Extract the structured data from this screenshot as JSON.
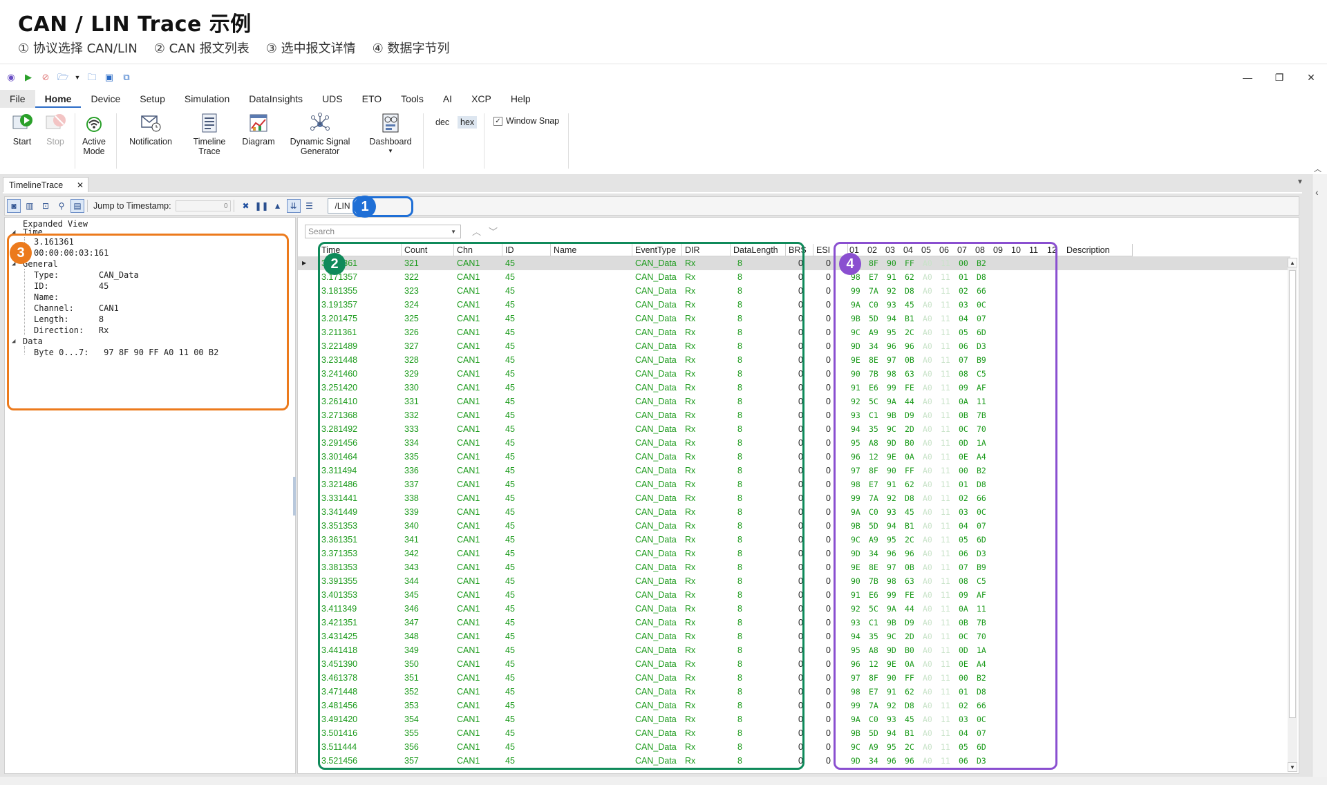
{
  "doc": {
    "title": "CAN / LIN Trace 示例",
    "steps": [
      "① 协议选择 CAN/LIN",
      "② CAN 报文列表",
      "③ 选中报文详情",
      "④ 数据字节列"
    ]
  },
  "menu": [
    "File",
    "Home",
    "Device",
    "Setup",
    "Simulation",
    "DataInsights",
    "UDS",
    "ETO",
    "Tools",
    "AI",
    "XCP",
    "Help"
  ],
  "ribbon": {
    "start": "Start",
    "stop": "Stop",
    "active_mode": "Active\nMode",
    "notification": "Notification",
    "timeline_trace": "Timeline\nTrace",
    "diagram": "Diagram",
    "dynamic_signal": "Dynamic Signal\nGenerator",
    "dashboard": "Dashboard",
    "dec": "dec",
    "hex": "hex",
    "window_snap": "Window Snap"
  },
  "tab": {
    "label": "TimelineTrace"
  },
  "toolbar": {
    "jump_label": "Jump to Timestamp:",
    "jump_value": "0",
    "protocol": "/LIN"
  },
  "search": {
    "placeholder": "Search"
  },
  "tree": {
    "expanded_view": "Expanded View",
    "time_label": "Time",
    "time_value": "3.161361",
    "time_fmt": "00:00:00:03:161",
    "general_label": "General",
    "type": "Type:        CAN_Data",
    "id": "ID:          45",
    "name": "Name:",
    "channel": "Channel:     CAN1",
    "length": "Length:      8",
    "direction": "Direction:   Rx",
    "data_label": "Data",
    "bytes": "Byte 0...7:   97 8F 90 FF A0 11 00 B2"
  },
  "columns": [
    "Time",
    "Count",
    "Chn",
    "ID",
    "Name",
    "EventType",
    "DIR",
    "DataLength",
    "BRS",
    "ESI",
    "01",
    "02",
    "03",
    "04",
    "05",
    "06",
    "07",
    "08",
    "09",
    "10",
    "11",
    "12",
    "Description"
  ],
  "rows": [
    [
      "3.161361",
      "321",
      "CAN1",
      "45",
      "",
      "CAN_Data",
      "Rx",
      "8",
      "0",
      "0",
      "97",
      "8F",
      "90",
      "FF",
      "A0",
      "11",
      "00",
      "B2"
    ],
    [
      "3.171357",
      "322",
      "CAN1",
      "45",
      "",
      "CAN_Data",
      "Rx",
      "8",
      "0",
      "0",
      "98",
      "E7",
      "91",
      "62",
      "A0",
      "11",
      "01",
      "D8"
    ],
    [
      "3.181355",
      "323",
      "CAN1",
      "45",
      "",
      "CAN_Data",
      "Rx",
      "8",
      "0",
      "0",
      "99",
      "7A",
      "92",
      "D8",
      "A0",
      "11",
      "02",
      "66"
    ],
    [
      "3.191357",
      "324",
      "CAN1",
      "45",
      "",
      "CAN_Data",
      "Rx",
      "8",
      "0",
      "0",
      "9A",
      "C0",
      "93",
      "45",
      "A0",
      "11",
      "03",
      "0C"
    ],
    [
      "3.201475",
      "325",
      "CAN1",
      "45",
      "",
      "CAN_Data",
      "Rx",
      "8",
      "0",
      "0",
      "9B",
      "5D",
      "94",
      "B1",
      "A0",
      "11",
      "04",
      "07"
    ],
    [
      "3.211361",
      "326",
      "CAN1",
      "45",
      "",
      "CAN_Data",
      "Rx",
      "8",
      "0",
      "0",
      "9C",
      "A9",
      "95",
      "2C",
      "A0",
      "11",
      "05",
      "6D"
    ],
    [
      "3.221489",
      "327",
      "CAN1",
      "45",
      "",
      "CAN_Data",
      "Rx",
      "8",
      "0",
      "0",
      "9D",
      "34",
      "96",
      "96",
      "A0",
      "11",
      "06",
      "D3"
    ],
    [
      "3.231448",
      "328",
      "CAN1",
      "45",
      "",
      "CAN_Data",
      "Rx",
      "8",
      "0",
      "0",
      "9E",
      "8E",
      "97",
      "0B",
      "A0",
      "11",
      "07",
      "B9"
    ],
    [
      "3.241460",
      "329",
      "CAN1",
      "45",
      "",
      "CAN_Data",
      "Rx",
      "8",
      "0",
      "0",
      "90",
      "7B",
      "98",
      "63",
      "A0",
      "11",
      "08",
      "C5"
    ],
    [
      "3.251420",
      "330",
      "CAN1",
      "45",
      "",
      "CAN_Data",
      "Rx",
      "8",
      "0",
      "0",
      "91",
      "E6",
      "99",
      "FE",
      "A0",
      "11",
      "09",
      "AF"
    ],
    [
      "3.261410",
      "331",
      "CAN1",
      "45",
      "",
      "CAN_Data",
      "Rx",
      "8",
      "0",
      "0",
      "92",
      "5C",
      "9A",
      "44",
      "A0",
      "11",
      "0A",
      "11"
    ],
    [
      "3.271368",
      "332",
      "CAN1",
      "45",
      "",
      "CAN_Data",
      "Rx",
      "8",
      "0",
      "0",
      "93",
      "C1",
      "9B",
      "D9",
      "A0",
      "11",
      "0B",
      "7B"
    ],
    [
      "3.281492",
      "333",
      "CAN1",
      "45",
      "",
      "CAN_Data",
      "Rx",
      "8",
      "0",
      "0",
      "94",
      "35",
      "9C",
      "2D",
      "A0",
      "11",
      "0C",
      "70"
    ],
    [
      "3.291456",
      "334",
      "CAN1",
      "45",
      "",
      "CAN_Data",
      "Rx",
      "8",
      "0",
      "0",
      "95",
      "A8",
      "9D",
      "B0",
      "A0",
      "11",
      "0D",
      "1A"
    ],
    [
      "3.301464",
      "335",
      "CAN1",
      "45",
      "",
      "CAN_Data",
      "Rx",
      "8",
      "0",
      "0",
      "96",
      "12",
      "9E",
      "0A",
      "A0",
      "11",
      "0E",
      "A4"
    ],
    [
      "3.311494",
      "336",
      "CAN1",
      "45",
      "",
      "CAN_Data",
      "Rx",
      "8",
      "0",
      "0",
      "97",
      "8F",
      "90",
      "FF",
      "A0",
      "11",
      "00",
      "B2"
    ],
    [
      "3.321486",
      "337",
      "CAN1",
      "45",
      "",
      "CAN_Data",
      "Rx",
      "8",
      "0",
      "0",
      "98",
      "E7",
      "91",
      "62",
      "A0",
      "11",
      "01",
      "D8"
    ],
    [
      "3.331441",
      "338",
      "CAN1",
      "45",
      "",
      "CAN_Data",
      "Rx",
      "8",
      "0",
      "0",
      "99",
      "7A",
      "92",
      "D8",
      "A0",
      "11",
      "02",
      "66"
    ],
    [
      "3.341449",
      "339",
      "CAN1",
      "45",
      "",
      "CAN_Data",
      "Rx",
      "8",
      "0",
      "0",
      "9A",
      "C0",
      "93",
      "45",
      "A0",
      "11",
      "03",
      "0C"
    ],
    [
      "3.351353",
      "340",
      "CAN1",
      "45",
      "",
      "CAN_Data",
      "Rx",
      "8",
      "0",
      "0",
      "9B",
      "5D",
      "94",
      "B1",
      "A0",
      "11",
      "04",
      "07"
    ],
    [
      "3.361351",
      "341",
      "CAN1",
      "45",
      "",
      "CAN_Data",
      "Rx",
      "8",
      "0",
      "0",
      "9C",
      "A9",
      "95",
      "2C",
      "A0",
      "11",
      "05",
      "6D"
    ],
    [
      "3.371353",
      "342",
      "CAN1",
      "45",
      "",
      "CAN_Data",
      "Rx",
      "8",
      "0",
      "0",
      "9D",
      "34",
      "96",
      "96",
      "A0",
      "11",
      "06",
      "D3"
    ],
    [
      "3.381353",
      "343",
      "CAN1",
      "45",
      "",
      "CAN_Data",
      "Rx",
      "8",
      "0",
      "0",
      "9E",
      "8E",
      "97",
      "0B",
      "A0",
      "11",
      "07",
      "B9"
    ],
    [
      "3.391355",
      "344",
      "CAN1",
      "45",
      "",
      "CAN_Data",
      "Rx",
      "8",
      "0",
      "0",
      "90",
      "7B",
      "98",
      "63",
      "A0",
      "11",
      "08",
      "C5"
    ],
    [
      "3.401353",
      "345",
      "CAN1",
      "45",
      "",
      "CAN_Data",
      "Rx",
      "8",
      "0",
      "0",
      "91",
      "E6",
      "99",
      "FE",
      "A0",
      "11",
      "09",
      "AF"
    ],
    [
      "3.411349",
      "346",
      "CAN1",
      "45",
      "",
      "CAN_Data",
      "Rx",
      "8",
      "0",
      "0",
      "92",
      "5C",
      "9A",
      "44",
      "A0",
      "11",
      "0A",
      "11"
    ],
    [
      "3.421351",
      "347",
      "CAN1",
      "45",
      "",
      "CAN_Data",
      "Rx",
      "8",
      "0",
      "0",
      "93",
      "C1",
      "9B",
      "D9",
      "A0",
      "11",
      "0B",
      "7B"
    ],
    [
      "3.431425",
      "348",
      "CAN1",
      "45",
      "",
      "CAN_Data",
      "Rx",
      "8",
      "0",
      "0",
      "94",
      "35",
      "9C",
      "2D",
      "A0",
      "11",
      "0C",
      "70"
    ],
    [
      "3.441418",
      "349",
      "CAN1",
      "45",
      "",
      "CAN_Data",
      "Rx",
      "8",
      "0",
      "0",
      "95",
      "A8",
      "9D",
      "B0",
      "A0",
      "11",
      "0D",
      "1A"
    ],
    [
      "3.451390",
      "350",
      "CAN1",
      "45",
      "",
      "CAN_Data",
      "Rx",
      "8",
      "0",
      "0",
      "96",
      "12",
      "9E",
      "0A",
      "A0",
      "11",
      "0E",
      "A4"
    ],
    [
      "3.461378",
      "351",
      "CAN1",
      "45",
      "",
      "CAN_Data",
      "Rx",
      "8",
      "0",
      "0",
      "97",
      "8F",
      "90",
      "FF",
      "A0",
      "11",
      "00",
      "B2"
    ],
    [
      "3.471448",
      "352",
      "CAN1",
      "45",
      "",
      "CAN_Data",
      "Rx",
      "8",
      "0",
      "0",
      "98",
      "E7",
      "91",
      "62",
      "A0",
      "11",
      "01",
      "D8"
    ],
    [
      "3.481456",
      "353",
      "CAN1",
      "45",
      "",
      "CAN_Data",
      "Rx",
      "8",
      "0",
      "0",
      "99",
      "7A",
      "92",
      "D8",
      "A0",
      "11",
      "02",
      "66"
    ],
    [
      "3.491420",
      "354",
      "CAN1",
      "45",
      "",
      "CAN_Data",
      "Rx",
      "8",
      "0",
      "0",
      "9A",
      "C0",
      "93",
      "45",
      "A0",
      "11",
      "03",
      "0C"
    ],
    [
      "3.501416",
      "355",
      "CAN1",
      "45",
      "",
      "CAN_Data",
      "Rx",
      "8",
      "0",
      "0",
      "9B",
      "5D",
      "94",
      "B1",
      "A0",
      "11",
      "04",
      "07"
    ],
    [
      "3.511444",
      "356",
      "CAN1",
      "45",
      "",
      "CAN_Data",
      "Rx",
      "8",
      "0",
      "0",
      "9C",
      "A9",
      "95",
      "2C",
      "A0",
      "11",
      "05",
      "6D"
    ],
    [
      "3.521456",
      "357",
      "CAN1",
      "45",
      "",
      "CAN_Data",
      "Rx",
      "8",
      "0",
      "0",
      "9D",
      "34",
      "96",
      "96",
      "A0",
      "11",
      "06",
      "D3"
    ]
  ],
  "annotations": [
    {
      "num": "1",
      "color": "#1f6fd6"
    },
    {
      "num": "2",
      "color": "#0f8a5a"
    },
    {
      "num": "3",
      "color": "#ec7a1c"
    },
    {
      "num": "4",
      "color": "#8a4fd0"
    }
  ],
  "colors": {
    "data_text": "#1a9a1a",
    "selected_row": "#dcdcdc",
    "accent": "#2a6bc6"
  }
}
